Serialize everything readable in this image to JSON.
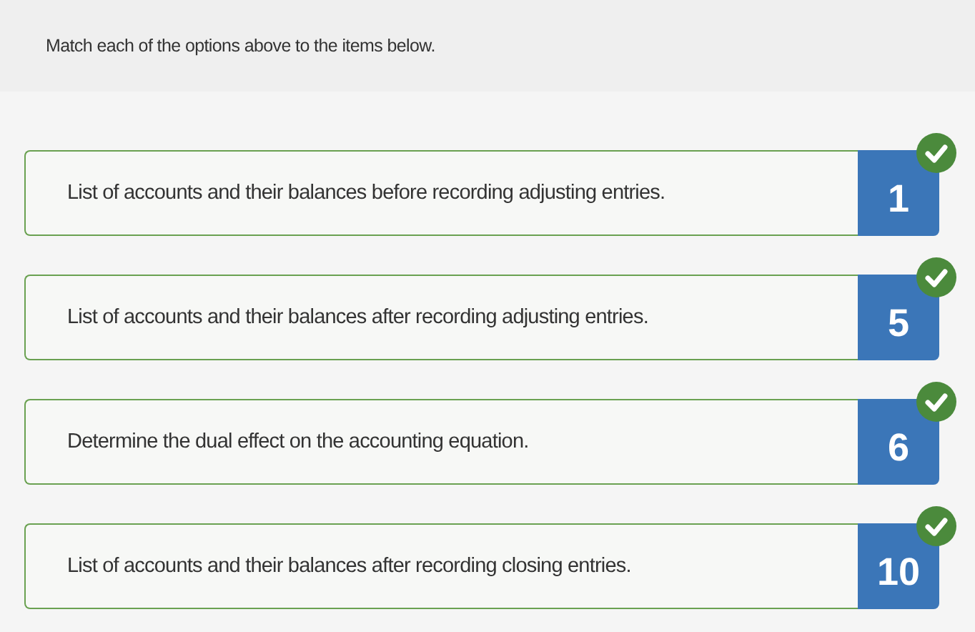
{
  "instruction": "Match each of the options above to the items below.",
  "items": [
    {
      "text": "List of accounts and their balances before recording adjusting entries.",
      "answer": "1",
      "correct": true
    },
    {
      "text": "List of accounts and their balances after recording adjusting entries.",
      "answer": "5",
      "correct": true
    },
    {
      "text": "Determine the dual effect on the accounting equation.",
      "answer": "6",
      "correct": true
    },
    {
      "text": "List of accounts and their balances after recording closing entries.",
      "answer": "10",
      "correct": true
    }
  ]
}
